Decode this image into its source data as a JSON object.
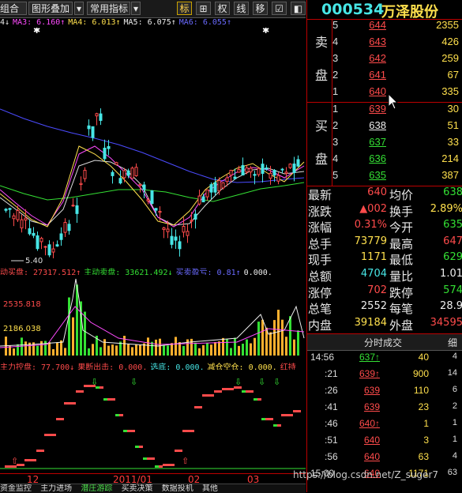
{
  "toolbar": {
    "combo_label": "组合",
    "overlay_label": "图形叠加",
    "indicator_label": "常用指标",
    "buttons": [
      "标",
      "⊞",
      "权",
      "线",
      "移",
      "☑",
      "◧",
      "◨"
    ]
  },
  "ma_legend": {
    "prefix": "4↓",
    "items": [
      {
        "text": "MA3: 6.160↑",
        "color": "#ff4bff"
      },
      {
        "text": "MA4: 6.013↑",
        "color": "#ffe04d"
      },
      {
        "text": "MA5: 6.075↑",
        "color": "#eeeeee"
      },
      {
        "text": "MA6: 6.055↑",
        "color": "#6a6aff"
      }
    ]
  },
  "low_marker": "5.40",
  "volume_legend": {
    "items": [
      {
        "text": "动买盘: 27317.512↑",
        "color": "#ff4b4b"
      },
      {
        "text": "主动卖盘: 33621.492↓",
        "color": "#34e034"
      },
      {
        "text": "买卖盈亏: 0.81↑",
        "color": "#6a6aff"
      },
      {
        "text": "0.000,",
        "color": "#eeeeee"
      }
    ],
    "level_high": "2535.818",
    "level_low": "2186.038"
  },
  "indicator_legend": {
    "items": [
      {
        "text": "主力控盘: 77.700↓",
        "color": "#ff4b4b"
      },
      {
        "text": "果断出击: 0.000,",
        "color": "#ff4b4b"
      },
      {
        "text": "选底: 0.000,",
        "color": "#47e6e6"
      },
      {
        "text": "减仓空仓: 0.000,",
        "color": "#ffe04d"
      },
      {
        "text": "红持",
        "color": "#ff4b4b"
      }
    ]
  },
  "date_axis": [
    "12",
    "2011/01",
    "02",
    "03"
  ],
  "bottom_tabs": {
    "items": [
      "资金监控",
      "主力进场",
      "潜庄游踪",
      "买卖决策",
      "数据投机",
      "其他"
    ],
    "active": 2
  },
  "stock": {
    "code": "000534",
    "name": "万泽股份"
  },
  "sell_label": [
    "卖",
    "盘"
  ],
  "buy_label": [
    "买",
    "盘"
  ],
  "asks": [
    {
      "level": "5",
      "price": "644",
      "volume": "2355"
    },
    {
      "level": "4",
      "price": "643",
      "volume": "426"
    },
    {
      "level": "3",
      "price": "642",
      "volume": "259"
    },
    {
      "level": "2",
      "price": "641",
      "volume": "67"
    },
    {
      "level": "1",
      "price": "640",
      "volume": "335"
    }
  ],
  "bids": [
    {
      "level": "1",
      "price": "639",
      "volume": "30",
      "color": "#ff4b4b"
    },
    {
      "level": "2",
      "price": "638",
      "volume": "51",
      "color": "#eeeeee"
    },
    {
      "level": "3",
      "price": "637",
      "volume": "33",
      "color": "#34e034"
    },
    {
      "level": "4",
      "price": "636",
      "volume": "214",
      "color": "#34e034"
    },
    {
      "level": "5",
      "price": "635",
      "volume": "387",
      "color": "#34e034"
    }
  ],
  "stats_left": [
    {
      "key": "最新",
      "value": "640",
      "color": "#ff4b4b"
    },
    {
      "key": "涨跌",
      "value": "▲002",
      "color": "#ff4b4b"
    },
    {
      "key": "涨幅",
      "value": "0.31%",
      "color": "#ff4b4b"
    },
    {
      "key": "总手",
      "value": "73779",
      "color": "#ffe04d"
    },
    {
      "key": "现手",
      "value": "1171",
      "color": "#ffe04d"
    },
    {
      "key": "总额",
      "value": "4704",
      "color": "#47e6e6"
    },
    {
      "key": "涨停",
      "value": "702",
      "color": "#ff4b4b"
    },
    {
      "key": "总笔",
      "value": "2552",
      "color": "#eeeeee"
    },
    {
      "key": "内盘",
      "value": "39184",
      "color": "#ffe04d"
    }
  ],
  "stats_right": [
    {
      "key": "均价",
      "value": "638",
      "color": "#34e034"
    },
    {
      "key": "换手",
      "value": "2.89%",
      "color": "#ffe04d"
    },
    {
      "key": "今开",
      "value": "635",
      "color": "#34e034"
    },
    {
      "key": "最高",
      "value": "647",
      "color": "#ff4b4b"
    },
    {
      "key": "最低",
      "value": "629",
      "color": "#34e034"
    },
    {
      "key": "量比",
      "value": "1.01",
      "color": "#eeeeee"
    },
    {
      "key": "跌停",
      "value": "574",
      "color": "#34e034"
    },
    {
      "key": "每笔",
      "value": "28.9",
      "color": "#eeeeee"
    },
    {
      "key": "外盘",
      "value": "34595",
      "color": "#ff4b4b"
    }
  ],
  "ticks_header": {
    "title": "分时成交",
    "detail": "细"
  },
  "ticks": [
    {
      "time": "14:56",
      "price": "637",
      "arrow": "↑",
      "volume": "40",
      "side": "4",
      "color": "#34e034"
    },
    {
      "time": ":21",
      "price": "639",
      "arrow": "↑",
      "volume": "900",
      "side": "14",
      "color": "#ff4b4b"
    },
    {
      "time": ":26",
      "price": "639",
      "arrow": "",
      "volume": "110",
      "side": "6",
      "color": "#ff4b4b"
    },
    {
      "time": ":41",
      "price": "639",
      "arrow": "",
      "volume": "23",
      "side": "2",
      "color": "#ff4b4b"
    },
    {
      "time": ":46",
      "price": "640",
      "arrow": "↑",
      "volume": "1",
      "side": "1",
      "color": "#ff4b4b"
    },
    {
      "time": ":51",
      "price": "640",
      "arrow": "",
      "volume": "3",
      "side": "1",
      "color": "#ff4b4b"
    },
    {
      "time": ":56",
      "price": "640",
      "arrow": "",
      "volume": "63",
      "side": "4",
      "color": "#ff4b4b"
    },
    {
      "time": "15:00",
      "price": "640",
      "arrow": "",
      "volume": "1171",
      "side": "63",
      "color": "#ff4b4b"
    }
  ],
  "watermark": "https://blog.csdn.net/Z_suger7"
}
